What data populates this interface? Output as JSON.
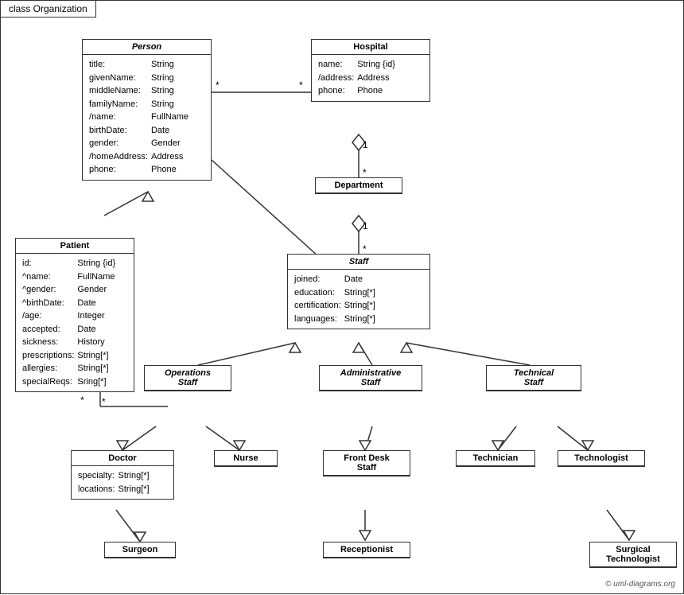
{
  "title": "class Organization",
  "copyright": "© uml-diagrams.org",
  "boxes": {
    "person": {
      "title": "Person",
      "italic": true,
      "attributes": [
        [
          "title:",
          "String"
        ],
        [
          "givenName:",
          "String"
        ],
        [
          "middleName:",
          "String"
        ],
        [
          "familyName:",
          "String"
        ],
        [
          "/name:",
          "FullName"
        ],
        [
          "birthDate:",
          "Date"
        ],
        [
          "gender:",
          "Gender"
        ],
        [
          "/homeAddress:",
          "Address"
        ],
        [
          "phone:",
          "Phone"
        ]
      ]
    },
    "hospital": {
      "title": "Hospital",
      "attributes": [
        [
          "name:",
          "String {id}"
        ],
        [
          "/address:",
          "Address"
        ],
        [
          "phone:",
          "Phone"
        ]
      ]
    },
    "patient": {
      "title": "Patient",
      "attributes": [
        [
          "id:",
          "String {id}"
        ],
        [
          "^name:",
          "FullName"
        ],
        [
          "^gender:",
          "Gender"
        ],
        [
          "^birthDate:",
          "Date"
        ],
        [
          "/age:",
          "Integer"
        ],
        [
          "accepted:",
          "Date"
        ],
        [
          "sickness:",
          "History"
        ],
        [
          "prescriptions:",
          "String[*]"
        ],
        [
          "allergies:",
          "String[*]"
        ],
        [
          "specialReqs:",
          "Sring[*]"
        ]
      ]
    },
    "department": {
      "title": "Department",
      "attributes": []
    },
    "staff": {
      "title": "Staff",
      "italic": true,
      "attributes": [
        [
          "joined:",
          "Date"
        ],
        [
          "education:",
          "String[*]"
        ],
        [
          "certification:",
          "String[*]"
        ],
        [
          "languages:",
          "String[*]"
        ]
      ]
    },
    "operations_staff": {
      "title": "Operations Staff",
      "italic": true,
      "attributes": []
    },
    "administrative_staff": {
      "title": "Administrative Staff",
      "italic": true,
      "attributes": []
    },
    "technical_staff": {
      "title": "Technical Staff",
      "italic": true,
      "attributes": []
    },
    "doctor": {
      "title": "Doctor",
      "attributes": [
        [
          "specialty:",
          "String[*]"
        ],
        [
          "locations:",
          "String[*]"
        ]
      ]
    },
    "nurse": {
      "title": "Nurse",
      "attributes": []
    },
    "front_desk_staff": {
      "title": "Front Desk Staff",
      "attributes": []
    },
    "technician": {
      "title": "Technician",
      "attributes": []
    },
    "technologist": {
      "title": "Technologist",
      "attributes": []
    },
    "surgeon": {
      "title": "Surgeon",
      "attributes": []
    },
    "receptionist": {
      "title": "Receptionist",
      "attributes": []
    },
    "surgical_technologist": {
      "title": "Surgical Technologist",
      "attributes": []
    }
  },
  "labels": {
    "star1": "*",
    "star2": "*",
    "star3": "*",
    "star4": "*",
    "one1": "1",
    "one2": "1"
  }
}
